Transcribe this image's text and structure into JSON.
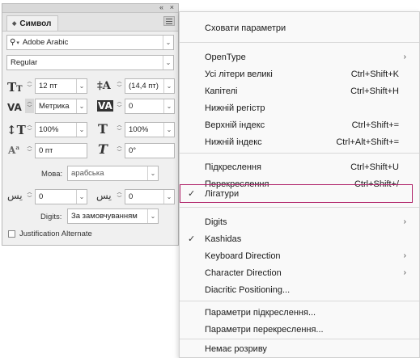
{
  "panel": {
    "title": "Символ",
    "collapse_glyph": "«",
    "close_glyph": "×",
    "font_family": "Adobe Arabic",
    "font_style": "Regular",
    "size": "12 пт",
    "leading": "(14,4 пт)",
    "kerning": "Метрика",
    "tracking": "0",
    "vertical_scale": "100%",
    "horizontal_scale": "100%",
    "baseline_shift": "0 пт",
    "skew": "0°",
    "language_label": "Мова:",
    "language_value": "арабська",
    "diacritic_x": "0",
    "diacritic_y": "0",
    "digits_label": "Digits:",
    "digits_value": "За замовчуванням",
    "justification_label": "Justification Alternate"
  },
  "menu": {
    "items": [
      {
        "label": "Сховати параметри",
        "shortcut": "",
        "arrow": "",
        "tick": ""
      },
      {
        "label": "OpenType",
        "shortcut": "",
        "arrow": "›",
        "tick": ""
      },
      {
        "label": "Усі літери великі",
        "shortcut": "Ctrl+Shift+K",
        "arrow": "",
        "tick": ""
      },
      {
        "label": "Капітелі",
        "shortcut": "Ctrl+Shift+H",
        "arrow": "",
        "tick": ""
      },
      {
        "label": "Нижній регістр",
        "shortcut": "",
        "arrow": "",
        "tick": ""
      },
      {
        "label": "Верхній індекс",
        "shortcut": "Ctrl+Shift+=",
        "arrow": "",
        "tick": ""
      },
      {
        "label": "Нижній індекс",
        "shortcut": "Ctrl+Alt+Shift+=",
        "arrow": "",
        "tick": ""
      },
      {
        "label": "Підкреслення",
        "shortcut": "Ctrl+Shift+U",
        "arrow": "",
        "tick": ""
      },
      {
        "label": "Перекреслення",
        "shortcut": "Ctrl+Shift+/",
        "arrow": "",
        "tick": ""
      },
      {
        "label": "Лігатури",
        "shortcut": "",
        "arrow": "",
        "tick": "✓"
      },
      {
        "label": "Digits",
        "shortcut": "",
        "arrow": "›",
        "tick": ""
      },
      {
        "label": "Kashidas",
        "shortcut": "",
        "arrow": "",
        "tick": "✓"
      },
      {
        "label": "Keyboard Direction",
        "shortcut": "",
        "arrow": "›",
        "tick": ""
      },
      {
        "label": "Character Direction",
        "shortcut": "",
        "arrow": "›",
        "tick": ""
      },
      {
        "label": "Diacritic Positioning...",
        "shortcut": "",
        "arrow": "",
        "tick": ""
      },
      {
        "label": "Параметри підкреслення...",
        "shortcut": "",
        "arrow": "",
        "tick": ""
      },
      {
        "label": "Параметри перекреслення...",
        "shortcut": "",
        "arrow": "",
        "tick": ""
      },
      {
        "label": "Немає розриву",
        "shortcut": "",
        "arrow": "",
        "tick": ""
      }
    ],
    "highlight_color": "#b0246a"
  },
  "icons": {
    "search": "magnifier-icon",
    "size": "font-size-icon",
    "leading": "leading-icon",
    "kerning": "kerning-icon",
    "tracking": "tracking-icon",
    "vertical_scale": "vertical-scale-icon",
    "horizontal_scale": "horizontal-scale-icon",
    "baseline": "baseline-shift-icon",
    "skew": "skew-icon",
    "diacritic": "arabic-diacritic-icon"
  }
}
